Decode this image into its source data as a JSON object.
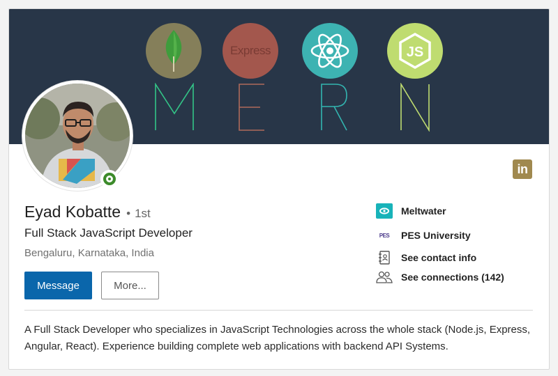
{
  "banner": {
    "express_logo_text": "Express",
    "mern_letters": [
      "M",
      "E",
      "R",
      "N"
    ],
    "colors": {
      "background": "#283648",
      "mongo": "#857f5a",
      "express": "#a3574d",
      "react": "#3db3b2",
      "node": "#bfdc70",
      "letter_m": "#33c487",
      "letter_e": "#b06a5b",
      "letter_r": "#33b5b0",
      "letter_n": "#bfdc70"
    }
  },
  "profile": {
    "name": "Eyad Kobatte",
    "degree": "1st",
    "headline": "Full Stack JavaScript Developer",
    "location": "Bengaluru, Karnataka, India",
    "online_status_color": "#3c8b2a"
  },
  "actions": {
    "message_label": "Message",
    "more_label": "More..."
  },
  "linkedin_badge": "in",
  "info": {
    "company": "Meltwater",
    "school": "PES University",
    "school_icon_text": "PES",
    "contact": "See contact info",
    "connections": "See connections (142)"
  },
  "summary": "A Full Stack Developer who specializes in JavaScript Technologies across the whole stack (Node.js, Express, Angular, React). Experience building complete web applications with backend API Systems."
}
